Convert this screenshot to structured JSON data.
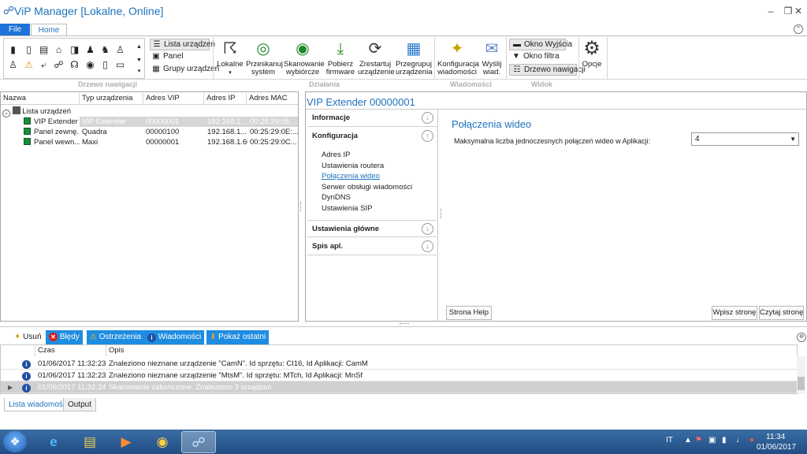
{
  "window": {
    "title": "ViP Manager [Lokalne, Online]",
    "minimize_icon": "minimize-icon",
    "restore_icon": "restore-icon",
    "close_icon": "close-icon"
  },
  "ribbon_tabs": {
    "file": "File",
    "home": "Home"
  },
  "ribbon": {
    "view_buttons": {
      "lista": "Lista urządzeń",
      "panel": "Panel",
      "grupy": "Grupy urządzeń"
    },
    "big_buttons": {
      "lokalne": "Lokalne",
      "przeskanuj": [
        "Przeskanuj",
        "system"
      ],
      "skanowanie": [
        "Skanowanie",
        "wybiórcze"
      ],
      "pobierz": [
        "Pobierz",
        "firmware"
      ],
      "zrestartuj": [
        "Zrestartuj",
        "urządzenie"
      ],
      "przegrupuj": [
        "Przegrupuj",
        "urządzenia"
      ],
      "konfiguracja": [
        "Konfiguracja",
        "wiadomości"
      ],
      "wyslij": [
        "Wyślij",
        "wiad."
      ],
      "opcje": "Opcje"
    },
    "window_buttons": {
      "okno_wyjscia": "Okno Wyjścia",
      "okno_filtra": "Okno filtra",
      "drzewo_nawigacji": "Drzewo nawigacji"
    },
    "group_labels": {
      "drzewo": "Drzewo nawigacji",
      "dzialania": "Działania",
      "wiadomosci": "Wiadomości",
      "widok": "Widok"
    }
  },
  "tree": {
    "columns": [
      "Nazwa",
      "Typ urządzenia",
      "Adres VIP",
      "Adres IP",
      "Adres MAC"
    ],
    "root": "Lista urządzeń",
    "rows": [
      {
        "name": "VIP Extender",
        "type": "VIP Extender",
        "vip": "00000001",
        "ip": "192.168.1....",
        "mac": "00:25:29:05:..."
      },
      {
        "name": "Panel zewnę...",
        "type": "Quadra",
        "vip": "00000100",
        "ip": "192.168.1....",
        "mac": "00:25:29:0E:..."
      },
      {
        "name": "Panel wewn...",
        "type": "Maxi",
        "vip": "00000001",
        "ip": "192.168.1.60",
        "mac": "00:25:29:0C..."
      }
    ]
  },
  "detail": {
    "title": "VIP Extender 00000001",
    "sections": {
      "informacje": "Informacje",
      "konfiguracja": "Konfiguracja",
      "ustawienia": "Ustawienia główne",
      "spis": "Spis apl."
    },
    "config_items": [
      "Adres IP",
      "Ustawienia routera",
      "Połączenia wideo",
      "Serwer obsługi wiadomości",
      "DynDNS",
      "Ustawienia SIP"
    ],
    "content_title": "Połączenia wideo",
    "field_label": "Maksymalna liczba jednoczesnych połączeń wideo w Aplikacji:",
    "field_value": "4",
    "buttons": {
      "help": "Strona Help",
      "wpisz": "Wpisz stronę",
      "czytaj": "Czytaj stronę"
    }
  },
  "log": {
    "toolbar": {
      "usun": "Usuń",
      "bledy": "Błędy",
      "ostrzezenia": "Ostrzeżenia",
      "wiadomosci": "Wiadomości",
      "pokaz": "Pokaż ostatni"
    },
    "columns": [
      "Czas",
      "Opis"
    ],
    "rows": [
      {
        "time": "01/06/2017 11:32:23",
        "desc": "Znaleziono nieznane urządzenie \"CamN\". Id sprzętu: CI16, Id Aplikacji: CamM"
      },
      {
        "time": "01/06/2017 11:32:23",
        "desc": "Znaleziono nieznane urządzenie \"MtsM\". Id sprzętu: MTch, Id Aplikacji: MnSf"
      },
      {
        "time": "01/06/2017 11:32:24",
        "desc": "Skanowanie zakończone. Znaleziono 3 urządzeń."
      }
    ],
    "tabs": {
      "lista": "Lista wiadomości",
      "output": "Output"
    }
  },
  "taskbar": {
    "lang": "IT",
    "time": "11:34",
    "date": "01/06/2017"
  },
  "colors": {
    "accent": "#1e73be",
    "file_tab": "#1e73d8",
    "log_toolbar": "#1e8ce0",
    "device_green": "#1d8a3a"
  }
}
